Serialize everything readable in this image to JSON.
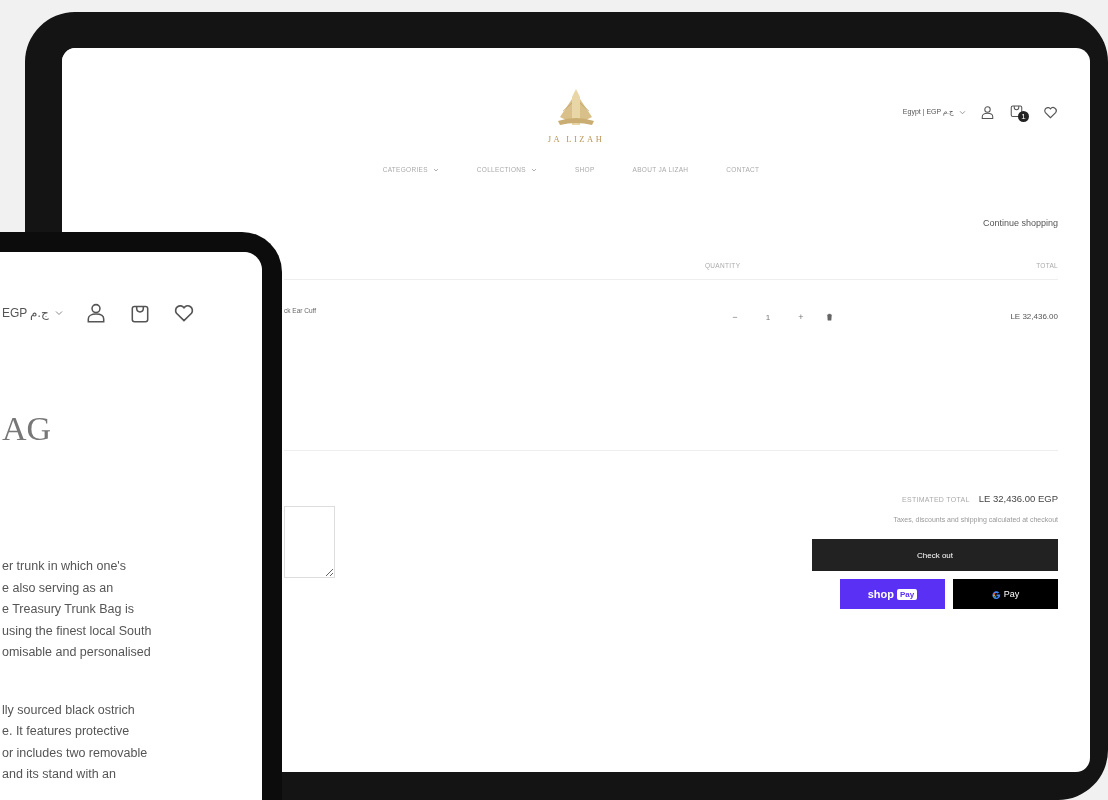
{
  "tablet": {
    "header": {
      "logo": "JA LIZAH",
      "locale": "Egypt | EGP ج.م",
      "cart_count": "1"
    },
    "nav": [
      {
        "label": "CATEGORIES",
        "dropdown": true
      },
      {
        "label": "COLLECTIONS",
        "dropdown": true
      },
      {
        "label": "SHOP",
        "dropdown": false
      },
      {
        "label": "ABOUT JA LIZAH",
        "dropdown": false
      },
      {
        "label": "CONTACT",
        "dropdown": false
      }
    ],
    "continue_link": "Continue shopping",
    "columns": [
      "QUANTITY",
      "TOTAL"
    ],
    "item": {
      "name": "ck Ear Cuff",
      "minus": "−",
      "quantity": "1",
      "plus": "+",
      "total": "LE 32,436.00"
    },
    "summary": {
      "label": "ESTIMATED TOTAL",
      "amount": "LE 32,436.00 EGP",
      "note": "Taxes, discounts and shipping calculated at checkout",
      "checkout": "Check out",
      "shop_pay": {
        "word": "shop",
        "badge": "Pay"
      },
      "google_pay": "Pay"
    }
  },
  "phone": {
    "locale": "EGP ج.م",
    "title": "AG",
    "paragraphs": [
      [
        "er trunk in which one's",
        "e also serving as an",
        "e Treasury Trunk Bag is",
        "using the finest local South",
        "omisable and personalised"
      ],
      [
        "lly sourced black ostrich",
        "e. It features protective",
        "or includes two removable",
        "and its stand with an"
      ]
    ]
  }
}
